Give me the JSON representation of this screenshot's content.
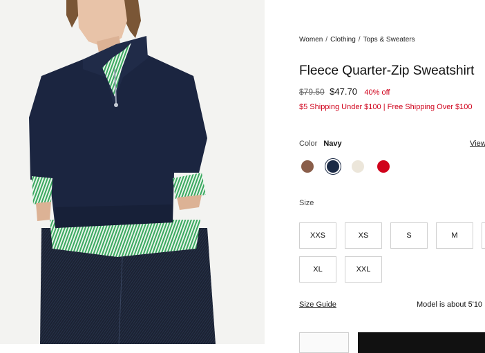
{
  "breadcrumbs": [
    "Women",
    "Clothing",
    "Tops & Sweaters"
  ],
  "breadcrumb_sep": "/",
  "product": {
    "title": "Fleece Quarter-Zip Sweatshirt",
    "original_price": "$79.50",
    "sale_price": "$47.70",
    "discount": "40% off",
    "shipping_note": "$5 Shipping Under $100 | Free Shipping Over $100"
  },
  "color": {
    "label": "Color",
    "selected": "Navy",
    "view_link": "View",
    "swatches": [
      {
        "name": "Brown",
        "hex": "#8a5e4a"
      },
      {
        "name": "Navy",
        "hex": "#1b2a45"
      },
      {
        "name": "Ivory",
        "hex": "#ece6da"
      },
      {
        "name": "Red",
        "hex": "#d0021b"
      }
    ]
  },
  "size": {
    "label": "Size",
    "options": [
      "XXS",
      "XS",
      "S",
      "M",
      "XL",
      "XXL"
    ]
  },
  "size_guide": "Size Guide",
  "model_note": "Model is about 5'10",
  "colors": {
    "sale_red": "#d0021b",
    "navy": "#1b2a45"
  }
}
